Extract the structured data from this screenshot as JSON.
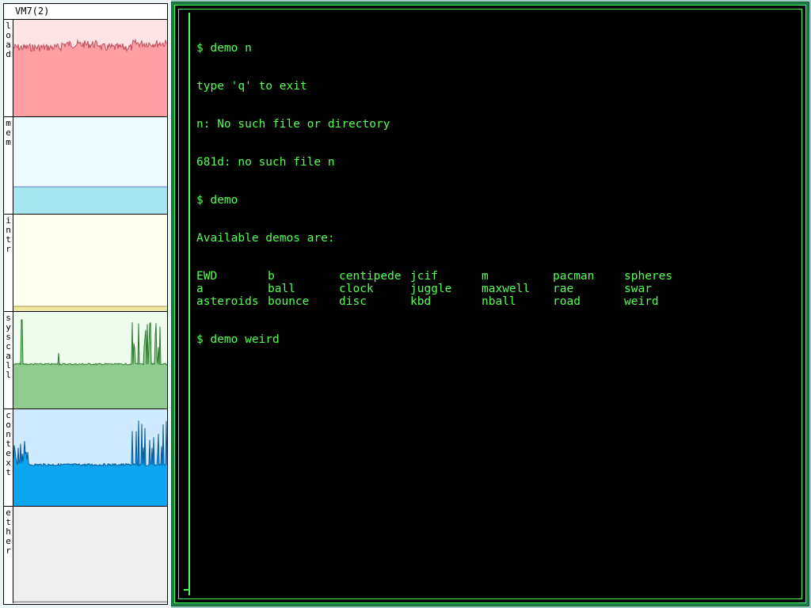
{
  "stats": {
    "title": "VM7(2)",
    "graphs": [
      {
        "label": "load",
        "bg": "#ffe4e6",
        "fill": "#ff9ea3",
        "stroke": "#c0505a",
        "profile": "load"
      },
      {
        "label": "mem",
        "bg": "#eefcff",
        "fill": "#a6e6ee",
        "stroke": "#5a78c8",
        "profile": "mem"
      },
      {
        "label": "intr",
        "bg": "#fffff0",
        "fill": "#eee6a0",
        "stroke": "#a89a40",
        "profile": "intr"
      },
      {
        "label": "syscall",
        "bg": "#eefcee",
        "fill": "#8ecd8e",
        "stroke": "#2e7a2e",
        "profile": "syscall"
      },
      {
        "label": "context",
        "bg": "#cdeaff",
        "fill": "#0ea5f0",
        "stroke": "#0a5a9a",
        "profile": "context"
      },
      {
        "label": "ether",
        "bg": "#eeeeee",
        "fill": "#cccccc",
        "stroke": "#888888",
        "profile": "ether"
      }
    ]
  },
  "terminal": {
    "lines_before": [
      "$ demo n",
      "type 'q' to exit",
      "n: No such file or directory",
      "681d: no such file n",
      "$ demo",
      "Available demos are:"
    ],
    "demos": [
      "EWD",
      "b",
      "centipede",
      "jcif",
      "m",
      "pacman",
      "spheres",
      "a",
      "ball",
      "clock",
      "juggle",
      "maxwell",
      "rae",
      "swar",
      "asteroids",
      "bounce",
      "disc",
      "kbd",
      "nball",
      "road",
      "weird"
    ],
    "lines_after": [
      "$ demo weird"
    ]
  },
  "colors": {
    "terminal_text": "#52ff52",
    "terminal_border": "#40ff5a",
    "terminal_frame": "#1f7a49"
  }
}
